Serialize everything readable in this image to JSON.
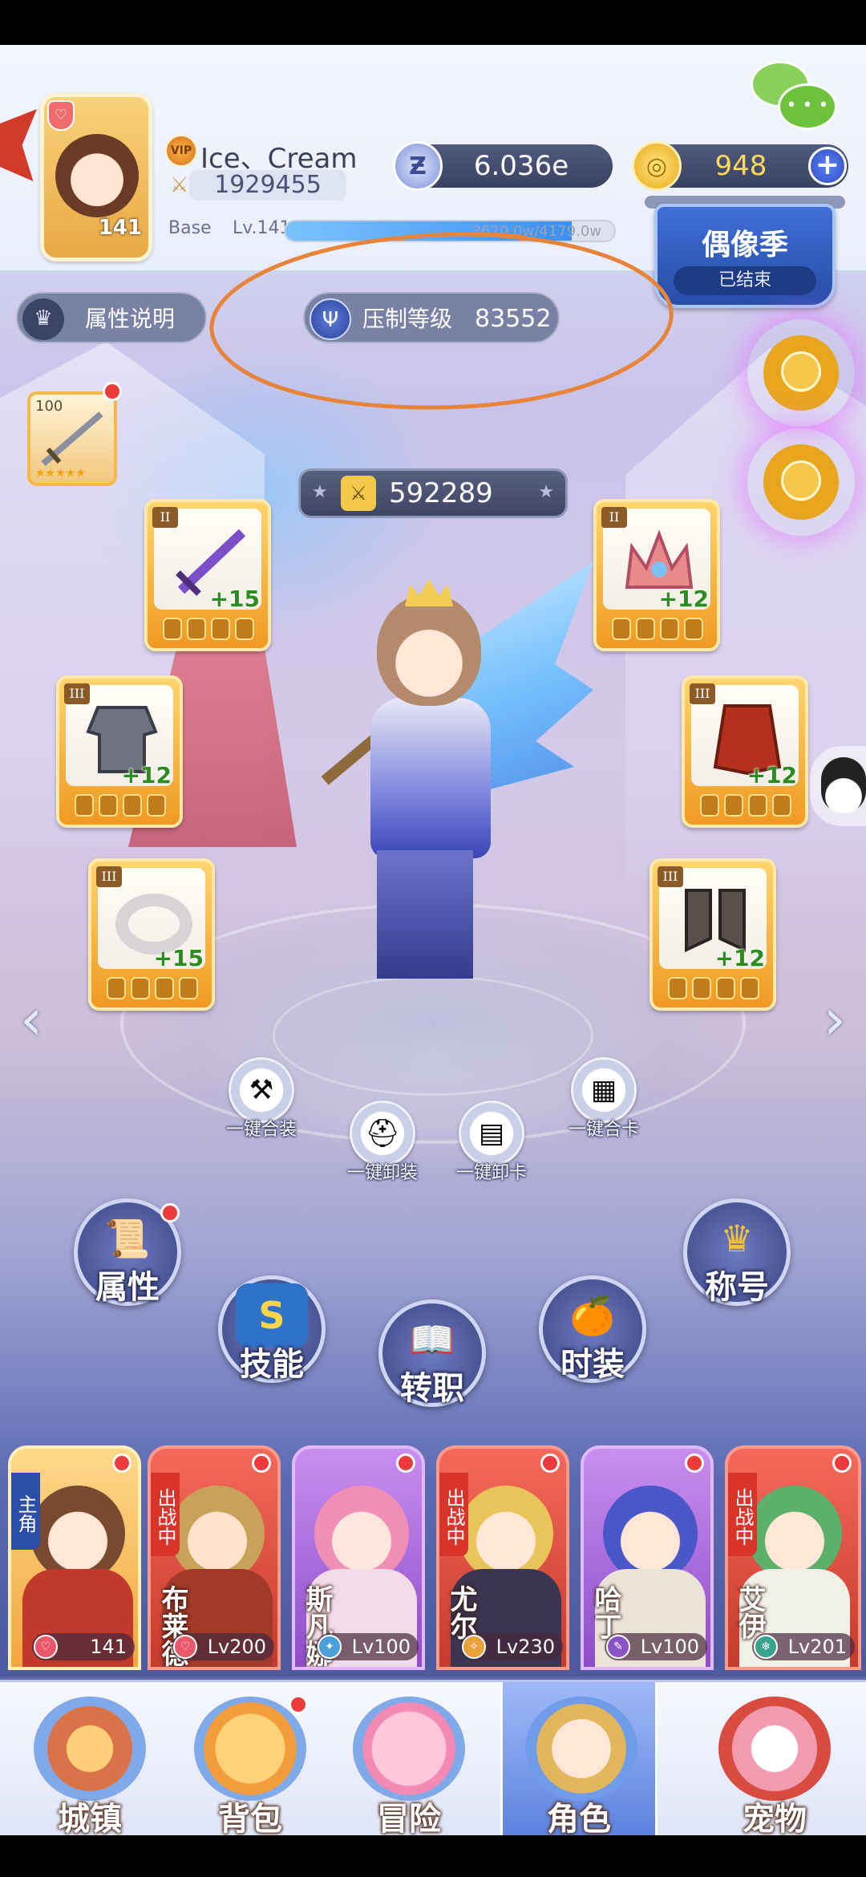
{
  "player": {
    "name": "Ice、Cream",
    "avatar_level": "141",
    "power": "1929455",
    "base_label": "Base",
    "base_level": "Lv.141",
    "exp_text": "3620.0w/4179.0w",
    "exp_progress": 0.87
  },
  "currency": {
    "zeny": "6.036e",
    "gold": "948",
    "add": "+"
  },
  "event": {
    "title": "偶像季",
    "status": "已结束"
  },
  "buttons": {
    "attr_info": "属性说明",
    "suppress_label": "压制等级",
    "suppress_value": "83552"
  },
  "combat_power": "592289",
  "weapon_slot": {
    "level": "100",
    "stars": "★★★★★"
  },
  "equipment": [
    {
      "tier": "II",
      "plus": "+15"
    },
    {
      "tier": "II",
      "plus": "+12"
    },
    {
      "tier": "III",
      "plus": "+12"
    },
    {
      "tier": "III",
      "plus": "+12"
    },
    {
      "tier": "III",
      "plus": "+15"
    },
    {
      "tier": "III",
      "plus": "+12"
    }
  ],
  "quick_actions": [
    "一键合装",
    "一键卸装",
    "一键卸卡",
    "一键合卡"
  ],
  "menu": {
    "attributes": "属性",
    "skills": "技能",
    "job_change": "转职",
    "costume": "时装",
    "title": "称号"
  },
  "roster": [
    {
      "tag": "主角",
      "name": "",
      "level": "141",
      "lv_prefix": ""
    },
    {
      "tag": "出战中",
      "name": "布莱德",
      "level": "200",
      "lv_prefix": "Lv"
    },
    {
      "tag": "",
      "name": "斯凡娜",
      "level": "100",
      "lv_prefix": "Lv"
    },
    {
      "tag": "出战中",
      "name": "尤尔",
      "level": "230",
      "lv_prefix": "Lv"
    },
    {
      "tag": "",
      "name": "哈丁",
      "level": "100",
      "lv_prefix": "Lv"
    },
    {
      "tag": "出战中",
      "name": "艾伊",
      "level": "201",
      "lv_prefix": "Lv"
    }
  ],
  "nav": {
    "town": "城镇",
    "bag": "背包",
    "adventure": "冒险",
    "character": "角色",
    "pet": "宠物"
  },
  "colors": {
    "annotation": "#e8843a",
    "accent": "#3b6fd6",
    "red_dot": "#ec3b3b"
  }
}
